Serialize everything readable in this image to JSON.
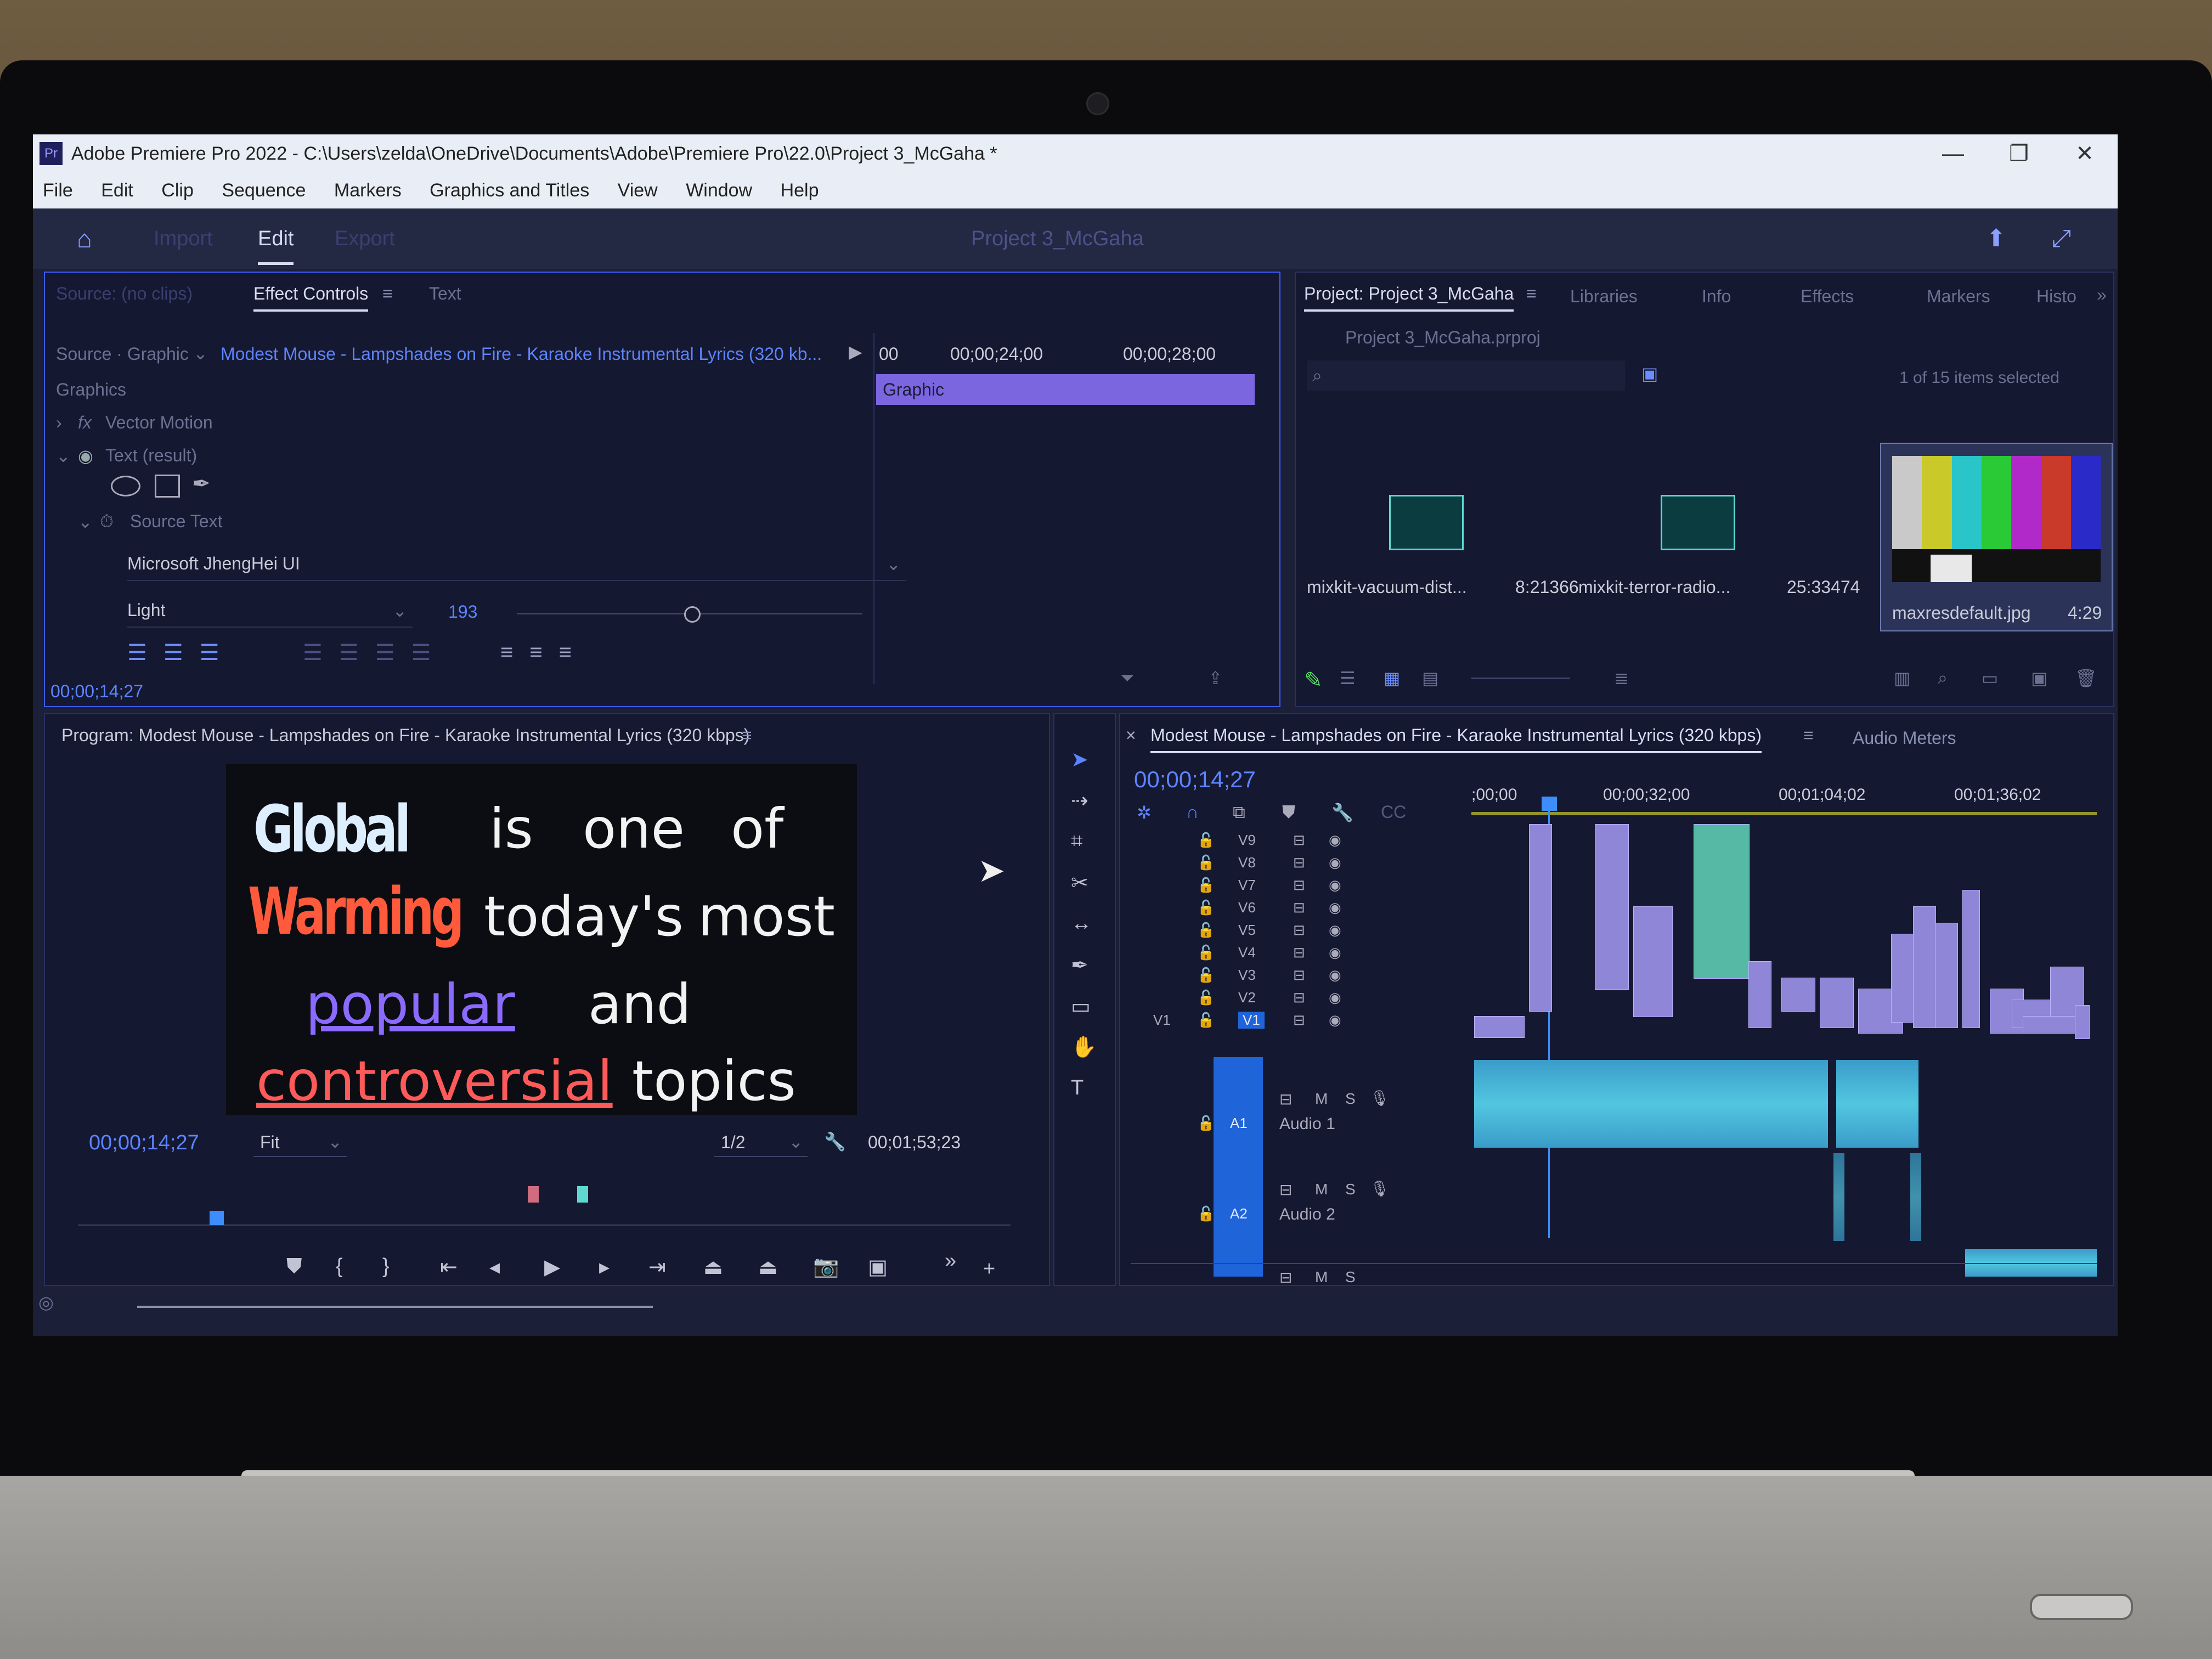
{
  "window": {
    "title": "Adobe Premiere Pro 2022 - C:\\Users\\zelda\\OneDrive\\Documents\\Adobe\\Premiere Pro\\22.0\\Project 3_McGaha *",
    "minimize": "—",
    "maximize": "❐",
    "close": "✕"
  },
  "menu": [
    "File",
    "Edit",
    "Clip",
    "Sequence",
    "Markers",
    "Graphics and Titles",
    "View",
    "Window",
    "Help"
  ],
  "workspace": {
    "tabs": [
      "Import",
      "Edit",
      "Export"
    ],
    "active": "Edit",
    "project_name": "Project 3_McGaha"
  },
  "effect_controls": {
    "tabs": [
      "Source: (no clips)",
      "Effect Controls",
      "Text"
    ],
    "source_label": "Source · Graphic",
    "clip_name": "Modest Mouse - Lampshades on Fire - Karaoke Instrumental Lyrics (320 kb...",
    "section": "Graphics",
    "rows": [
      "Vector Motion",
      "Text (result)",
      "Source Text"
    ],
    "font": "Microsoft JhengHei UI",
    "style": "Light",
    "size": "193",
    "timecode": "00;00;14;27",
    "timeline_ticks": [
      "00",
      "00;00;24;00",
      "00;00;28;00"
    ],
    "graphic_bar": "Graphic"
  },
  "project": {
    "tabs": [
      "Project: Project 3_McGaha",
      "Libraries",
      "Info",
      "Effects",
      "Markers",
      "Histo"
    ],
    "file": "Project 3_McGaha.prproj",
    "selection": "1 of 15 items selected",
    "items": [
      {
        "name": "mixkit-vacuum-dist...",
        "duration": "8:21366"
      },
      {
        "name": "mixkit-terror-radio...",
        "duration": "25:33474"
      },
      {
        "name": "maxresdefault.jpg",
        "duration": "4:29"
      }
    ],
    "bars_colors": [
      "#c9c9c9",
      "#c9c92a",
      "#29c5c9",
      "#2ac936",
      "#b12ac9",
      "#c93a2a",
      "#2a2ac9"
    ]
  },
  "program": {
    "title": "Program: Modest Mouse - Lampshades on Fire - Karaoke Instrumental Lyrics (320 kbps)",
    "timecode": "00;00;14;27",
    "fit": "Fit",
    "quality": "1/2",
    "duration": "00;01;53;23",
    "lyrics": {
      "w1": "Global",
      "w2": "Warming",
      "w3": "is",
      "w4": "one",
      "w5": "of",
      "w6": "today's",
      "w7": "most",
      "w8": "popular",
      "w9": "and",
      "w10": "controversial",
      "w11": "topics"
    }
  },
  "timeline": {
    "title": "Modest Mouse - Lampshades on Fire - Karaoke Instrumental Lyrics (320 kbps)",
    "audio_meters": "Audio Meters",
    "timecode": "00;00;14;27",
    "ruler": [
      ";00;00",
      "00;00;32;00",
      "00;01;04;02",
      "00;01;36;02"
    ],
    "video_tracks": [
      "V9",
      "V8",
      "V7",
      "V6",
      "V5",
      "V4",
      "V3",
      "V2",
      "V1"
    ],
    "source_patch": "V1",
    "audio_tracks": [
      {
        "id": "A1",
        "name": "Audio 1"
      },
      {
        "id": "A2",
        "name": "Audio 2"
      }
    ],
    "m": "M",
    "s": "S"
  }
}
